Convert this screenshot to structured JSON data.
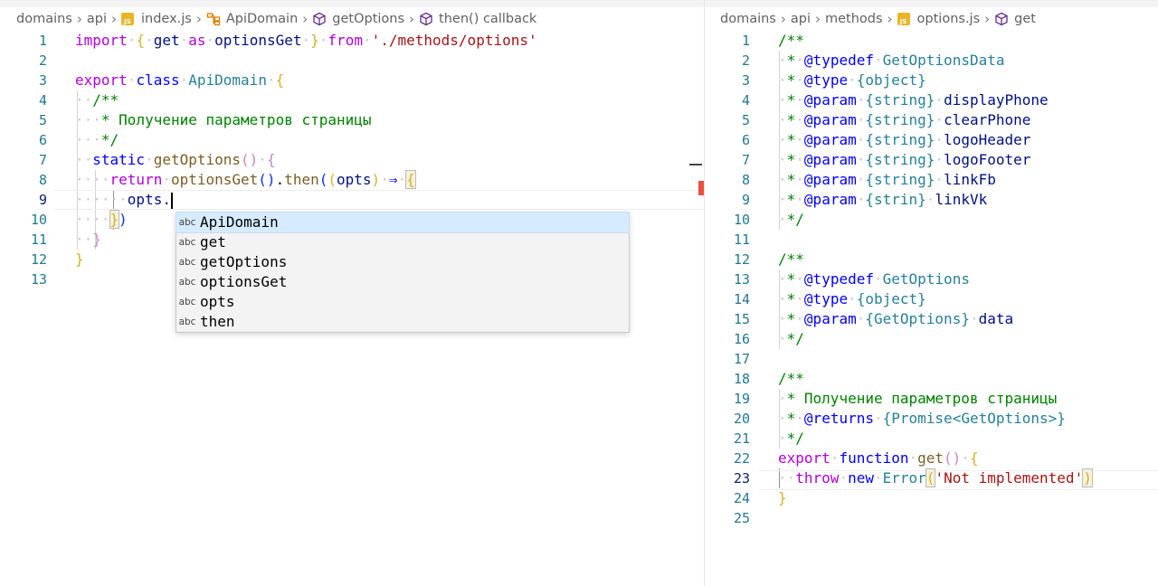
{
  "left": {
    "breadcrumb": [
      "domains",
      "api",
      "index.js",
      "ApiDomain",
      "getOptions",
      "then() callback"
    ],
    "js_icon_text": "JS",
    "line_numbers": [
      "1",
      "2",
      "3",
      "4",
      "5",
      "6",
      "7",
      "8",
      "9",
      "10",
      "11",
      "12",
      "13"
    ],
    "code": {
      "l1": {
        "import": "import",
        "b_open": "{",
        "get": "get",
        "as": "as",
        "alias": "optionsGet",
        "b_close": "}",
        "from": "from",
        "path": "'./methods/options'"
      },
      "l3": {
        "export": "export",
        "class": "class",
        "name": "ApiDomain",
        "brace": "{"
      },
      "l4": {
        "comment": "/**"
      },
      "l5": {
        "comment": "* Получение параметров страницы"
      },
      "l6": {
        "comment": "*/"
      },
      "l7": {
        "static": "static",
        "name": "getOptions",
        "parens": "()",
        "brace": "{"
      },
      "l8": {
        "return": "return",
        "fn": "optionsGet",
        "parens": "()",
        "dot": ".",
        "then": "then",
        "p_open": "(",
        "p_open2": "(",
        "param": "opts",
        "p_close2": ")",
        "arrow": "⇒",
        "brace": "{"
      },
      "l9": {
        "text": "opts."
      },
      "l10": {
        "brace": "}",
        "paren": ")"
      },
      "l11": {
        "brace": "}"
      },
      "l12": {
        "brace": "}"
      }
    },
    "suggestions": [
      {
        "kind": "abc",
        "label": "ApiDomain",
        "selected": true
      },
      {
        "kind": "abc",
        "label": "get",
        "selected": false
      },
      {
        "kind": "abc",
        "label": "getOptions",
        "selected": false
      },
      {
        "kind": "abc",
        "label": "optionsGet",
        "selected": false
      },
      {
        "kind": "abc",
        "label": "opts",
        "selected": false
      },
      {
        "kind": "abc",
        "label": "then",
        "selected": false
      }
    ]
  },
  "right": {
    "breadcrumb": [
      "domains",
      "api",
      "methods",
      "options.js",
      "get"
    ],
    "js_icon_text": "JS",
    "line_numbers": [
      "1",
      "2",
      "3",
      "4",
      "5",
      "6",
      "7",
      "8",
      "9",
      "10",
      "11",
      "12",
      "13",
      "14",
      "15",
      "16",
      "17",
      "18",
      "19",
      "20",
      "21",
      "22",
      "23",
      "24",
      "25"
    ],
    "code": {
      "l1": "/**",
      "l2": {
        "star": "*",
        "tag": "@typedef",
        "name": "GetOptionsData"
      },
      "l3": {
        "star": "*",
        "tag": "@type",
        "type": "{object}"
      },
      "l4": {
        "star": "*",
        "tag": "@param",
        "type": "{string}",
        "name": "displayPhone"
      },
      "l5": {
        "star": "*",
        "tag": "@param",
        "type": "{string}",
        "name": "clearPhone"
      },
      "l6": {
        "star": "*",
        "tag": "@param",
        "type": "{string}",
        "name": "logoHeader"
      },
      "l7": {
        "star": "*",
        "tag": "@param",
        "type": "{string}",
        "name": "logoFooter"
      },
      "l8": {
        "star": "*",
        "tag": "@param",
        "type": "{string}",
        "name": "linkFb"
      },
      "l9": {
        "star": "*",
        "tag": "@param",
        "type": "{strin}",
        "name": "linkVk"
      },
      "l10": "*/",
      "l12": "/**",
      "l13": {
        "star": "*",
        "tag": "@typedef",
        "name": "GetOptions"
      },
      "l14": {
        "star": "*",
        "tag": "@type",
        "type": "{object}"
      },
      "l15": {
        "star": "*",
        "tag": "@param",
        "type": "{GetOptions}",
        "name": "data"
      },
      "l16": "*/",
      "l18": "/**",
      "l19": "* Получение параметров страницы",
      "l20": {
        "star": "*",
        "tag": "@returns",
        "type": "{Promise<GetOptions>}"
      },
      "l21": "*/",
      "l22": {
        "export": "export",
        "function": "function",
        "name": "get",
        "parens": "()",
        "brace": "{"
      },
      "l23": {
        "throw": "throw",
        "new": "new",
        "cls": "Error",
        "p_open": "(",
        "str": "'Not implemented'",
        "p_close": ")"
      },
      "l24": {
        "brace": "}"
      }
    }
  },
  "colors": {
    "keyword": "#0000ff",
    "control_keyword": "#af00db",
    "identifier": "#001080",
    "function": "#795e26",
    "class": "#267f99",
    "string": "#a31515",
    "comment": "#008000",
    "line_number": "#237893",
    "suggest_selected": "#d6ebff"
  },
  "icons": {
    "js_file": "js-file-icon",
    "class": "class-icon",
    "method": "cube-icon",
    "chevron": "chevron-right-icon"
  }
}
